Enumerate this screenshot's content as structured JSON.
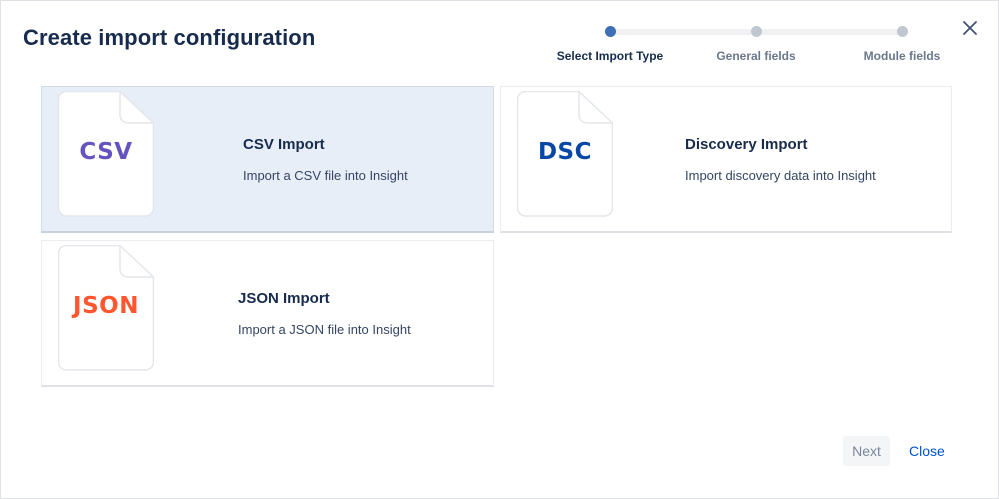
{
  "dialog": {
    "title": "Create import configuration",
    "close_icon": "close-icon"
  },
  "stepper": {
    "steps": [
      {
        "label": "Select Import Type",
        "active": true
      },
      {
        "label": "General fields",
        "active": false
      },
      {
        "label": "Module fields",
        "active": false
      }
    ]
  },
  "cards": [
    {
      "ext": "CSV",
      "ext_color": "#6554c0",
      "title": "CSV Import",
      "description": "Import a CSV file into Insight",
      "selected": true
    },
    {
      "ext": "DSC",
      "ext_color": "#0747a6",
      "title": "Discovery Import",
      "description": "Import discovery data into Insight",
      "selected": false
    },
    {
      "ext": "JSON",
      "ext_color": "#ff5630",
      "title": "JSON Import",
      "description": "Import a JSON file into Insight",
      "selected": false
    }
  ],
  "footer": {
    "next_label": "Next",
    "close_label": "Close"
  },
  "colors": {
    "accent": "#0052cc",
    "selected_card_bg": "#e8eef7",
    "active_step": "#3e6fb5"
  }
}
